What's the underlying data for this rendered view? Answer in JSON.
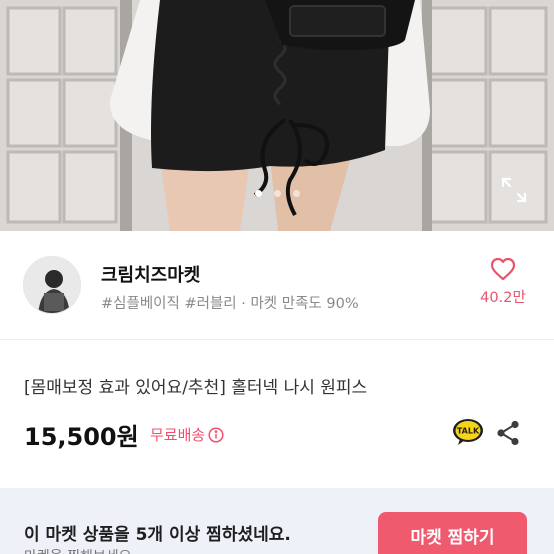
{
  "photo": {
    "alt_subject": "",
    "slide_count": 3,
    "active_slide": 1
  },
  "seller": {
    "name": "크림치즈마켓",
    "tags": "#심플베이직 #러블리 · 마켓 만족도 90%",
    "like_count": "40.2만"
  },
  "product": {
    "title": "[몸매보정 효과 있어요/추천] 홀터넥 나시 원피스",
    "price": "15,500원",
    "shipping": "무료배송"
  },
  "banner": {
    "message": "이 마켓 상품을 5개 이상 찜하셨네요.",
    "sub_message": "마켓을 찜해보세요",
    "button_label": "마켓 찜하기"
  },
  "colors": {
    "accent": "#ef5a6f",
    "like": "#e8546b",
    "banner_bg": "#eef1f8",
    "talk_yellow": "#f7d417"
  },
  "icons": {
    "expand": "expand-icon",
    "heart": "heart-icon",
    "info": "info-icon",
    "talk": "kakao-talk-icon",
    "share": "share-icon"
  }
}
